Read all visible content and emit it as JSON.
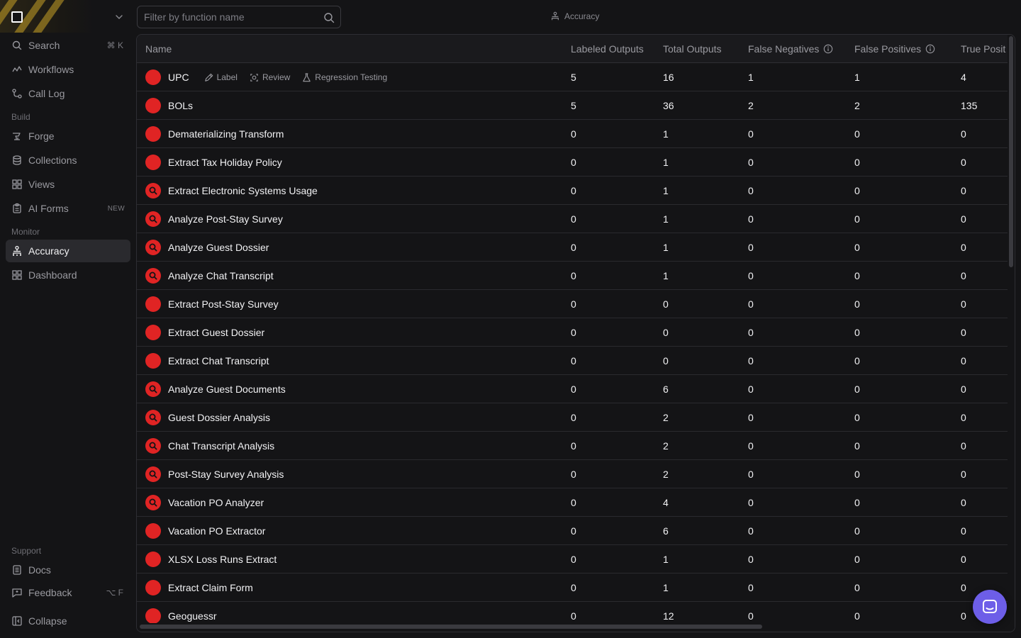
{
  "sidebar": {
    "brand_accent": "#c9a227",
    "search": {
      "label": "Search",
      "shortcut": "⌘ K",
      "icon": "search-icon"
    },
    "top_items": [
      {
        "label": "Workflows",
        "icon": "workflow-icon"
      },
      {
        "label": "Call Log",
        "icon": "call-log-icon"
      }
    ],
    "sections": {
      "build": "Build",
      "monitor": "Monitor",
      "support": "Support"
    },
    "build_items": [
      {
        "label": "Forge",
        "icon": "anvil-icon"
      },
      {
        "label": "Collections",
        "icon": "database-icon"
      },
      {
        "label": "Views",
        "icon": "grid-icon"
      },
      {
        "label": "AI Forms",
        "icon": "clipboard-icon",
        "badge": "NEW"
      }
    ],
    "monitor_items": [
      {
        "label": "Accuracy",
        "icon": "accuracy-icon",
        "active": true
      },
      {
        "label": "Dashboard",
        "icon": "dashboard-icon"
      }
    ],
    "support_items": [
      {
        "label": "Docs",
        "icon": "docs-icon"
      },
      {
        "label": "Feedback",
        "icon": "feedback-icon",
        "shortcut": "⌥ F"
      }
    ],
    "collapse": {
      "label": "Collapse",
      "icon": "collapse-icon"
    }
  },
  "filter": {
    "placeholder": "Filter by function name",
    "value": ""
  },
  "breadcrumb": {
    "label": "Accuracy",
    "icon": "accuracy-icon"
  },
  "table": {
    "columns": [
      "Name",
      "Labeled Outputs",
      "Total Outputs",
      "False Negatives",
      "False Positives",
      "True Posit"
    ],
    "row_actions": [
      {
        "label": "Label",
        "icon": "pen-icon"
      },
      {
        "label": "Review",
        "icon": "review-icon"
      },
      {
        "label": "Regression Testing",
        "icon": "flask-icon"
      }
    ],
    "rows": [
      {
        "name": "UPC",
        "labeled": "5",
        "total": "16",
        "fn": "1",
        "fp": "1",
        "tp": "4",
        "icon": "dot",
        "show_actions": true
      },
      {
        "name": "BOLs",
        "labeled": "5",
        "total": "36",
        "fn": "2",
        "fp": "2",
        "tp": "135",
        "icon": "dot"
      },
      {
        "name": "Dematerializing Transform",
        "labeled": "0",
        "total": "1",
        "fn": "0",
        "fp": "0",
        "tp": "0",
        "icon": "dot"
      },
      {
        "name": "Extract Tax Holiday Policy",
        "labeled": "0",
        "total": "1",
        "fn": "0",
        "fp": "0",
        "tp": "0",
        "icon": "dot"
      },
      {
        "name": "Extract Electronic Systems Usage",
        "labeled": "0",
        "total": "1",
        "fn": "0",
        "fp": "0",
        "tp": "0",
        "icon": "search"
      },
      {
        "name": "Analyze Post-Stay Survey",
        "labeled": "0",
        "total": "1",
        "fn": "0",
        "fp": "0",
        "tp": "0",
        "icon": "search"
      },
      {
        "name": "Analyze Guest Dossier",
        "labeled": "0",
        "total": "1",
        "fn": "0",
        "fp": "0",
        "tp": "0",
        "icon": "search"
      },
      {
        "name": "Analyze Chat Transcript",
        "labeled": "0",
        "total": "1",
        "fn": "0",
        "fp": "0",
        "tp": "0",
        "icon": "search"
      },
      {
        "name": "Extract Post-Stay Survey",
        "labeled": "0",
        "total": "0",
        "fn": "0",
        "fp": "0",
        "tp": "0",
        "icon": "dot"
      },
      {
        "name": "Extract Guest Dossier",
        "labeled": "0",
        "total": "0",
        "fn": "0",
        "fp": "0",
        "tp": "0",
        "icon": "dot"
      },
      {
        "name": "Extract Chat Transcript",
        "labeled": "0",
        "total": "0",
        "fn": "0",
        "fp": "0",
        "tp": "0",
        "icon": "dot"
      },
      {
        "name": "Analyze Guest Documents",
        "labeled": "0",
        "total": "6",
        "fn": "0",
        "fp": "0",
        "tp": "0",
        "icon": "search"
      },
      {
        "name": "Guest Dossier Analysis",
        "labeled": "0",
        "total": "2",
        "fn": "0",
        "fp": "0",
        "tp": "0",
        "icon": "search"
      },
      {
        "name": "Chat Transcript Analysis",
        "labeled": "0",
        "total": "2",
        "fn": "0",
        "fp": "0",
        "tp": "0",
        "icon": "search"
      },
      {
        "name": "Post-Stay Survey Analysis",
        "labeled": "0",
        "total": "2",
        "fn": "0",
        "fp": "0",
        "tp": "0",
        "icon": "search"
      },
      {
        "name": "Vacation PO Analyzer",
        "labeled": "0",
        "total": "4",
        "fn": "0",
        "fp": "0",
        "tp": "0",
        "icon": "search"
      },
      {
        "name": "Vacation PO Extractor",
        "labeled": "0",
        "total": "6",
        "fn": "0",
        "fp": "0",
        "tp": "0",
        "icon": "dot"
      },
      {
        "name": "XLSX Loss Runs Extract",
        "labeled": "0",
        "total": "1",
        "fn": "0",
        "fp": "0",
        "tp": "0",
        "icon": "dot"
      },
      {
        "name": "Extract Claim Form",
        "labeled": "0",
        "total": "1",
        "fn": "0",
        "fp": "0",
        "tp": "0",
        "icon": "dot"
      },
      {
        "name": "Geoguessr",
        "labeled": "0",
        "total": "12",
        "fn": "0",
        "fp": "0",
        "tp": "0",
        "icon": "dot"
      }
    ]
  },
  "colors": {
    "status_red": "#e02424",
    "chat_button": "#6d5ee8",
    "active_bg": "#2a2a2e"
  },
  "chat_button": {
    "icon": "chat-icon"
  }
}
